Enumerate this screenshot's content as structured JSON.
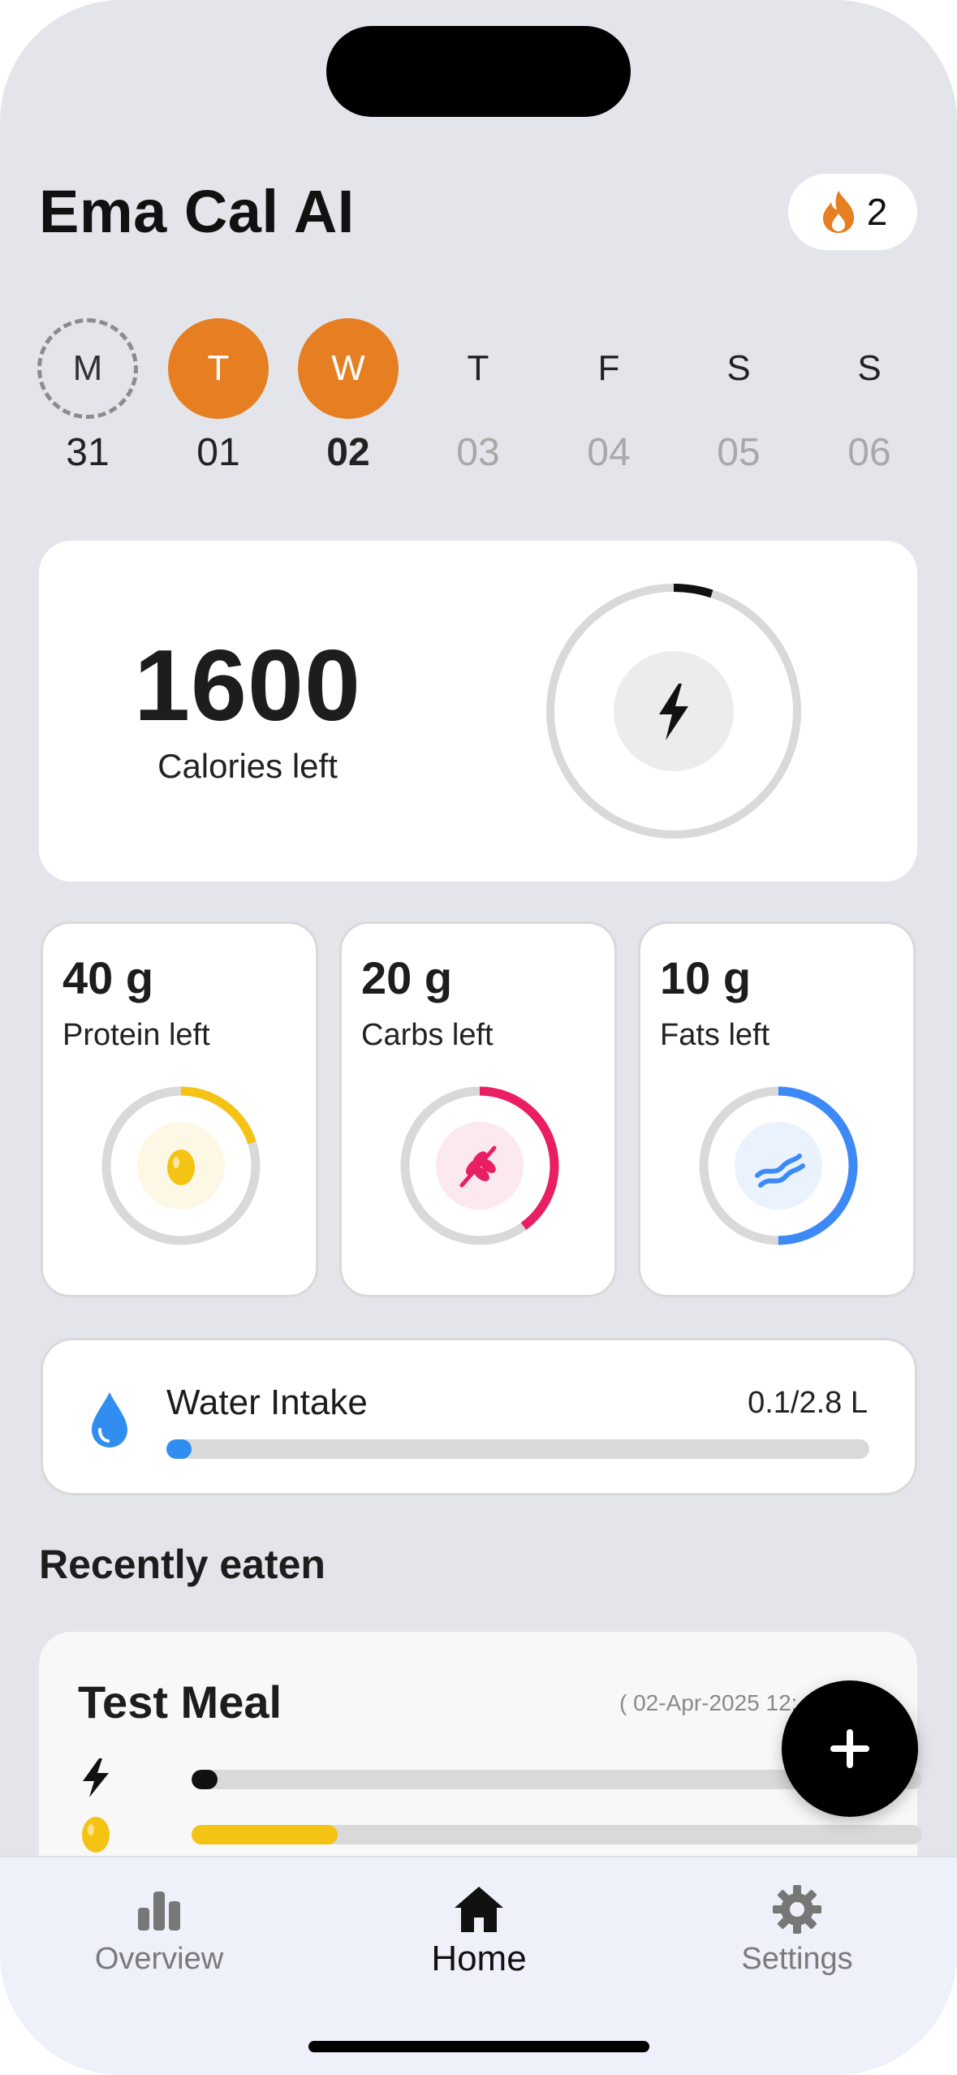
{
  "app": {
    "title": "Ema Cal AI",
    "streak_count": "2"
  },
  "week": [
    {
      "letter": "M",
      "date": "31",
      "state": "missed"
    },
    {
      "letter": "T",
      "date": "01",
      "state": "done"
    },
    {
      "letter": "W",
      "date": "02",
      "state": "current"
    },
    {
      "letter": "T",
      "date": "03",
      "state": "future"
    },
    {
      "letter": "F",
      "date": "04",
      "state": "future"
    },
    {
      "letter": "S",
      "date": "05",
      "state": "future"
    },
    {
      "letter": "S",
      "date": "06",
      "state": "future"
    }
  ],
  "calories": {
    "value": "1600",
    "label": "Calories left",
    "progress": 0.05
  },
  "macros": [
    {
      "value": "40 g",
      "label": "Protein left",
      "color": "#f5c314",
      "icon": "egg-icon",
      "progress": 0.2
    },
    {
      "value": "20 g",
      "label": "Carbs left",
      "color": "#e91e63",
      "icon": "wheat-icon",
      "progress": 0.4
    },
    {
      "value": "10 g",
      "label": "Fats left",
      "color": "#3d8af7",
      "icon": "bacon-icon",
      "progress": 0.5
    }
  ],
  "water": {
    "title": "Water Intake",
    "amount": "0.1/2.8 L",
    "progress": 0.036
  },
  "recent": {
    "title": "Recently eaten",
    "meal": {
      "name": "Test Meal",
      "date": "( 02-Apr-2025 12:",
      "calorie_progress": 0.036,
      "protein_progress": 0.2
    }
  },
  "nav": {
    "overview": "Overview",
    "home": "Home",
    "settings": "Settings"
  },
  "colors": {
    "accent": "#e67e22",
    "background": "#e3e5eb",
    "water": "#2f8ef0"
  }
}
